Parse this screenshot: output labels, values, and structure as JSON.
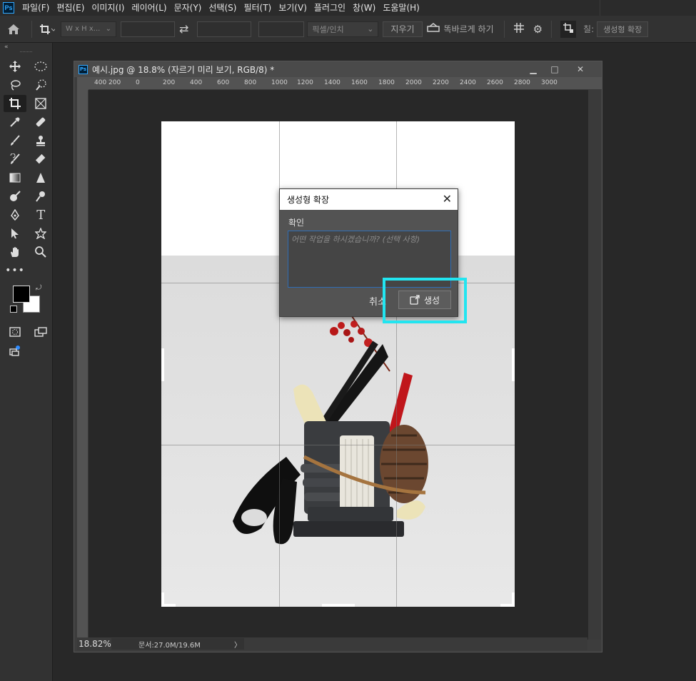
{
  "app": {
    "logo": "Ps",
    "menu": [
      "파일(F)",
      "편집(E)",
      "이미지(I)",
      "레이어(L)",
      "문자(Y)",
      "선택(S)",
      "필터(T)",
      "보기(V)",
      "플러그인",
      "창(W)",
      "도움말(H)"
    ]
  },
  "options": {
    "ratio_select": "W x H x...",
    "unit_select": "픽셀/인치",
    "clear_button": "지우기",
    "straighten_label": "똑바르게 하기",
    "fill_label": "칠:",
    "fill_value": "생성형 확장"
  },
  "document": {
    "logo": "Ps",
    "title": "예시.jpg @ 18.8% (자르기 미리 보기, RGB/8) *",
    "minimize": "▁",
    "restore": "□",
    "close": "✕",
    "ruler_ticks": [
      "400",
      "200",
      "0",
      "200",
      "400",
      "600",
      "800",
      "1000",
      "1200",
      "1400",
      "1600",
      "1800",
      "2000",
      "2200",
      "2400",
      "2600",
      "2800",
      "3000"
    ],
    "zoom": "18.82%",
    "doc_info": "문서:27.0M/19.6M",
    "status_arrow": "〉"
  },
  "dialog": {
    "title": "생성형 확장",
    "close": "✕",
    "prompt_label": "확인",
    "prompt_placeholder": "어떤 작업을 하시겠습니까? (선택 사항)",
    "cancel_label": "취소",
    "generate_label": "생성"
  },
  "colors": {
    "accent_highlight": "#22e5f0",
    "input_focus": "#2f6db5",
    "foreground": "#000000",
    "background": "#ffffff"
  }
}
